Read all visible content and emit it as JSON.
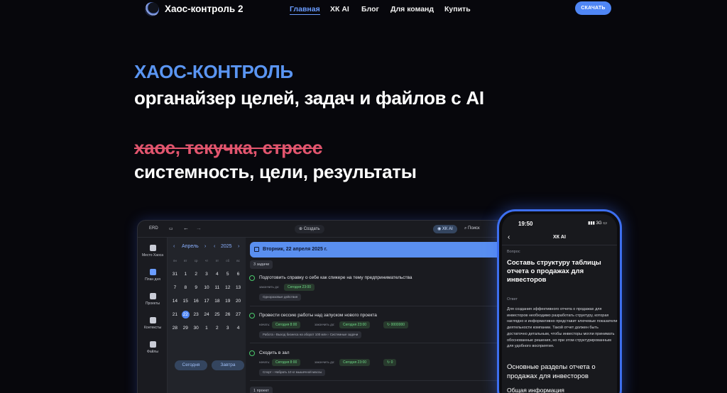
{
  "nav": {
    "brand": "Хаос-контроль 2",
    "links": [
      "Главная",
      "ХК AI",
      "Блог",
      "Для команд",
      "Купить"
    ],
    "cta": "СКАЧАТЬ"
  },
  "hero": {
    "kicker": "ХАОС-КОНТРОЛЬ",
    "title": "органайзер целей, задач и файлов с AI",
    "strike": "хаос, текучка, стресс",
    "result": "системность, цели, результаты"
  },
  "app": {
    "top": {
      "label_left": "ERD",
      "create": "Создать",
      "ai": "ХК AI",
      "search": "Поиск"
    },
    "rail": [
      "Место Хаоса",
      "План дня",
      "Проекты",
      "Контексты",
      "Файлы"
    ],
    "calendar": {
      "month": "Апрель",
      "year": "2025",
      "weekdays": [
        "пн",
        "вт",
        "ср",
        "чт",
        "пт",
        "сб",
        "вс"
      ],
      "days": [
        "31",
        "1",
        "2",
        "3",
        "4",
        "5",
        "6",
        "7",
        "8",
        "9",
        "10",
        "11",
        "12",
        "13",
        "14",
        "15",
        "16",
        "17",
        "18",
        "19",
        "20",
        "21",
        "22",
        "23",
        "24",
        "25",
        "26",
        "27",
        "28",
        "29",
        "30",
        "1",
        "2",
        "3",
        "4"
      ],
      "today_index": 22,
      "today_btn": "Сегодня",
      "tomorrow_btn": "Завтра"
    },
    "date": "Вторник, 22 апреля 2025 г.",
    "task_count": "3 задачи",
    "tasks": [
      {
        "title": "Подготовить справку о себе как спикере на тему предпринимательства",
        "meta1": "закончить до:",
        "chip1": "Сегодня 23:00",
        "tag": "Одноразовые действия"
      },
      {
        "title": "Провести сессию работы над запуском нового проекта",
        "meta1": "начать:",
        "chip1": "Сегодня 8:00",
        "meta2": "закончить до:",
        "chip2": "Сегодня 23:00",
        "chip3": "0000000",
        "tag": "Работа › Выход бизнеса на оборот 100 млн › Системные задачи"
      },
      {
        "title": "Сходить в зал",
        "meta1": "начать:",
        "chip1": "Сегодня 8:00",
        "meta2": "закончить до:",
        "chip2": "Сегодня 23:00",
        "chip3": "0",
        "tag": "Спорт › Набрать 10 кг мышечной массы"
      }
    ],
    "project_count": "1 проект"
  },
  "phone": {
    "time": "19:50",
    "status": "3G",
    "title": "ХК AI",
    "q_label": "Вопрос",
    "question": "Составь структуру таблицы отчета о продажах для инвесторов",
    "a_label": "Ответ",
    "answer": "Для создания эффективного отчета о продажах для инвесторов необходимо разработать структуру, которая наглядно и информативно представит ключевые показатели деятельности компании. Такой отчет должен быть достаточно детальным, чтобы инвесторы могли принимать обоснованные решения, но при этом структурированным для удобного восприятия.",
    "heading": "Основные разделы отчета о продажах для инвесторов",
    "sub": "Общая информация"
  },
  "colors": {
    "accent": "#4f86f5",
    "kicker": "#5a95f2",
    "strike": "#e2556e",
    "background": "#07070c"
  }
}
